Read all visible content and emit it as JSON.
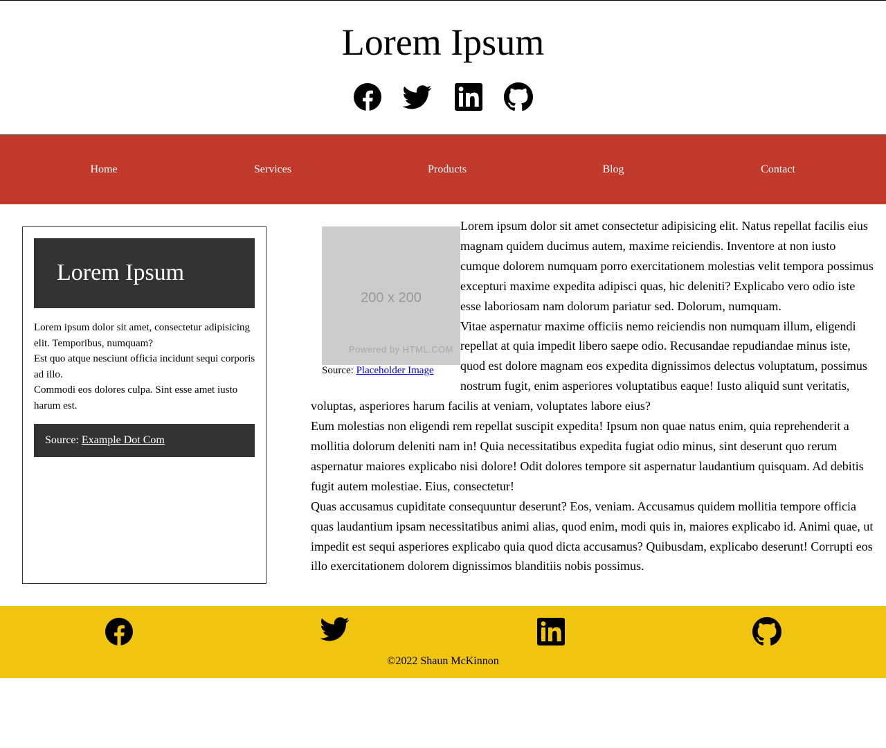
{
  "header": {
    "title": "Lorem Ipsum",
    "social": [
      "facebook-icon",
      "twitter-icon",
      "linkedin-icon",
      "github-icon"
    ]
  },
  "nav": {
    "items": [
      {
        "label": "Home"
      },
      {
        "label": "Services"
      },
      {
        "label": "Products"
      },
      {
        "label": "Blog"
      },
      {
        "label": "Contact"
      }
    ]
  },
  "sidebar": {
    "title": "Lorem Ipsum",
    "paragraphs": [
      "Lorem ipsum dolor sit amet, consectetur adipisicing elit. Temporibus, numquam?",
      "Est quo atque nesciunt officia incidunt sequi corporis ad illo.",
      "Commodi eos dolores culpa. Sint esse amet iusto harum est."
    ],
    "source_prefix": "Source: ",
    "source_link": "Example Dot Com"
  },
  "main": {
    "image": {
      "dimensions": "200 x 200",
      "powered_by": "Powered by HTML.COM",
      "caption_prefix": "Source: ",
      "caption_link": "Placeholder Image"
    },
    "paragraphs": [
      "Lorem ipsum dolor sit amet consectetur adipisicing elit. Natus repellat facilis eius magnam quidem ducimus autem, maxime reiciendis. Inventore at non iusto cumque dolorem numquam porro exercitationem molestias velit tempora possimus excepturi maxime expedita adipisci quas, hic deleniti? Explicabo vero odio iste esse laboriosam nam dolorum pariatur sed. Dolorum, numquam.",
      "Vitae aspernatur maxime officiis nemo reiciendis non numquam illum, eligendi repellat at quia impedit libero saepe odio. Recusandae repudiandae minus iste, quod est dolore magnam eos expedita dignissimos delectus voluptatum, possimus nostrum fugit, enim asperiores voluptatibus eaque! Iusto aliquid sunt veritatis, voluptas, asperiores harum facilis at veniam, voluptates labore eius?",
      "Eum molestias non eligendi rem repellat suscipit expedita! Ipsum non quae natus enim, quia reprehenderit a mollitia dolorum deleniti nam in! Quia necessitatibus expedita fugiat odio minus, sint deserunt quo rerum aspernatur maiores explicabo nisi dolore! Odit dolores tempore sit aspernatur laudantium quisquam. Ad debitis fugit autem molestiae. Eius, consectetur!",
      "Quas accusamus cupiditate consequuntur deserunt? Eos, veniam. Accusamus quidem mollitia tempore officia quas laudantium ipsam necessitatibus animi alias, quod enim, modi quis in, maiores explicabo id. Animi quae, ut impedit est sequi asperiores explicabo quia quod dicta accusamus? Quibusdam, explicabo deserunt! Corrupti eos illo exercitationem dolorem dignissimos blanditiis nobis possimus."
    ]
  },
  "footer": {
    "social": [
      "facebook-icon",
      "twitter-icon",
      "linkedin-icon",
      "github-icon"
    ],
    "copyright": "©2022 Shaun McKinnon"
  },
  "colors": {
    "nav_background": "#c0392b",
    "footer_background": "#f1c40f",
    "panel_dark": "#333333",
    "placeholder_gray": "#cccccc"
  }
}
